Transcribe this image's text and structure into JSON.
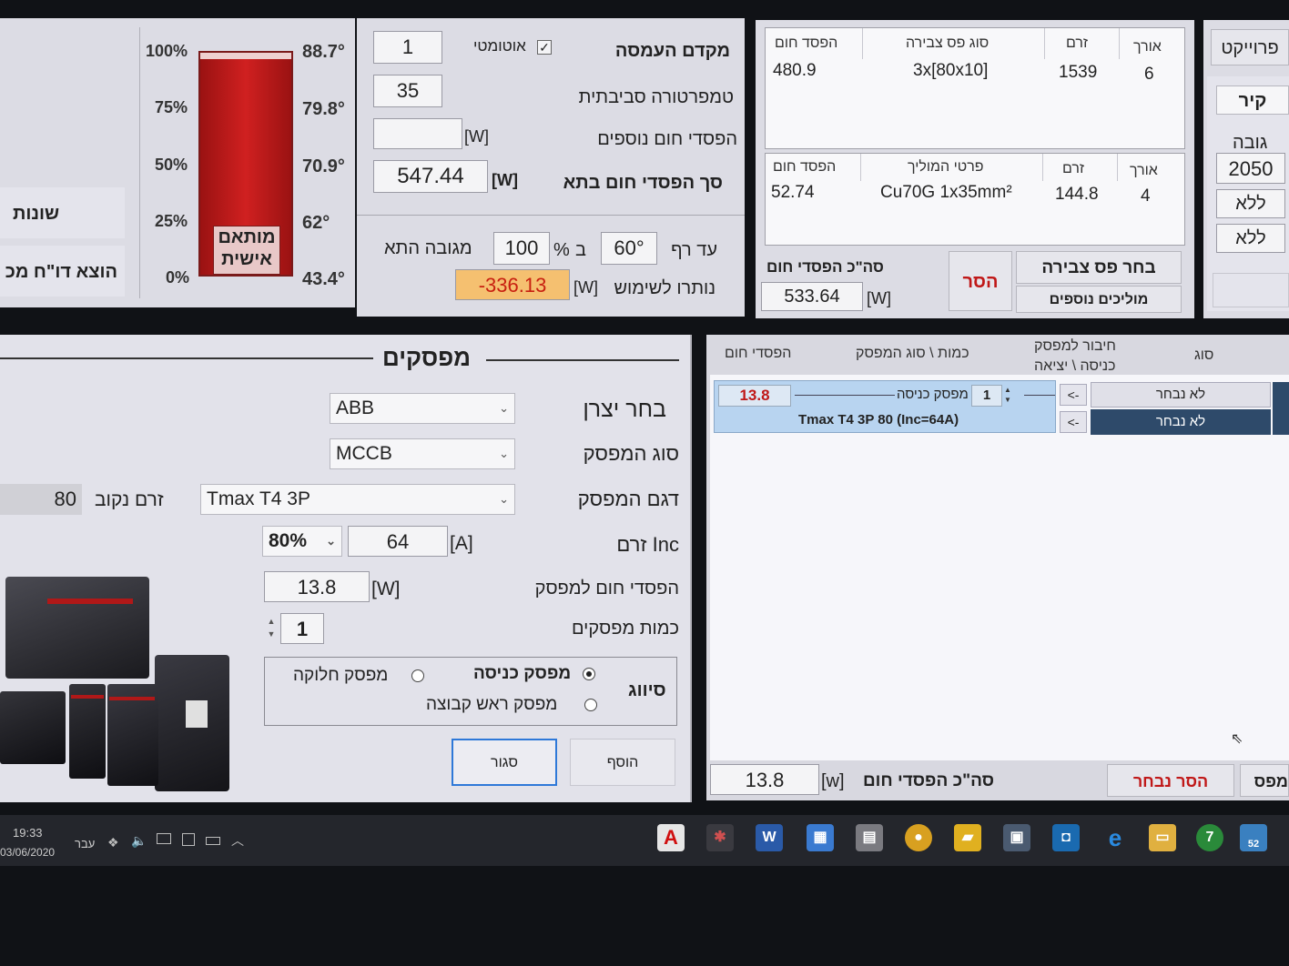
{
  "thermometer": {
    "pct_ticks": [
      "100%",
      "75%",
      "50%",
      "25%",
      "0%"
    ],
    "temp_ticks": [
      "88.7°",
      "79.8°",
      "70.9°",
      "62°",
      "43.4°"
    ],
    "badge_line1": "מותאם",
    "badge_line2": "אישית",
    "fill_fraction": 0.97
  },
  "left_buttons": {
    "various": "שונות",
    "export_report": "הוצא דו\"ח מכ"
  },
  "heat": {
    "load_factor_label": "מקדם העמסה",
    "load_factor_value": "1",
    "auto_label": "אוטומטי",
    "ambient_label": "טמפרטורה סביבתית",
    "ambient_value": "35",
    "extra_label": "הפסדי חום נוספים",
    "extra_value": "",
    "unit_w": "[W]",
    "total_label": "סך הפסדי חום בתא",
    "total_value": "547.44",
    "until_label": "עד רף",
    "until_value": "60°",
    "in_label": "ב",
    "percent_sign": "%",
    "percent_value": "100",
    "height_label": "מגובה התא",
    "remaining_label": "נותרו לשימוש",
    "remaining_value": "-336.13"
  },
  "busbar_table": {
    "headers": [
      "הפסד חום",
      "סוג פס צבירה",
      "זרם",
      "אורך"
    ],
    "row": [
      "480.9",
      "3x[80x10]",
      "1539",
      "6"
    ]
  },
  "conductor_table": {
    "headers": [
      "הפסד חום",
      "פרטי המוליך",
      "זרם",
      "אורך"
    ],
    "row": [
      "52.74",
      "Cu70G 1x35mm²",
      "144.8",
      "4"
    ]
  },
  "busbar_total": {
    "label": "סה\"כ הפסדי חום",
    "value": "533.64",
    "unit": "[W]",
    "remove": "הסר",
    "choose_busbar": "בחר פס צבירה",
    "extra_conductors": "מוליכים נוספים"
  },
  "right_strip": {
    "project": "פרוייקט",
    "wall": "קיר",
    "height_label": "גובה",
    "height_value": "2050",
    "none1": "ללא",
    "none2": "ללא"
  },
  "breakers": {
    "title": "מפסקים",
    "manufacturer_label": "בחר יצרן",
    "manufacturer_value": "ABB",
    "type_label": "סוג המפסק",
    "type_value": "MCCB",
    "model_label": "דגם המפסק",
    "model_value": "Tmax T4 3P",
    "rated_label": "זרם נקוב",
    "rated_value": "80",
    "inc_label": "זרם Inc",
    "inc_pct": "80%",
    "inc_value": "64",
    "unit_a": "[A]",
    "loss_label": "הפסדי חום למפסק",
    "loss_value": "13.8",
    "unit_w": "[W]",
    "qty_label": "כמות מפסקים",
    "qty_value": "1",
    "class_label": "סיווג",
    "opt_incoming": "מפסק כניסה",
    "opt_outgoing": "מפסק חלוקה",
    "opt_group": "מפסק ראש קבוצה",
    "btn_add": "הוסף",
    "btn_close": "סגור"
  },
  "list": {
    "headers": {
      "loss": "הפסדי חום",
      "qty_type": "כמות \\ סוג המפסק",
      "connect1": "חיבור למפסק",
      "connect2": "כניסה \\ יציאה",
      "kind": "סוג"
    },
    "row": {
      "loss": "13.8",
      "kind": "מפסק כניסה",
      "qty": "1",
      "name": "Tmax T4 3P 80 (Inc=64A)",
      "arrow": "<-",
      "not_selected": "לא נבחר"
    },
    "total_label": "סה\"כ הפסדי חום",
    "total_value": "13.8",
    "unit": "[w]",
    "remove_selected": "הסר נבחר",
    "cut_label": "מפס"
  },
  "taskbar": {
    "time": "19:33",
    "date": "03/06/2020",
    "lang": "עבר",
    "badge": "52"
  }
}
